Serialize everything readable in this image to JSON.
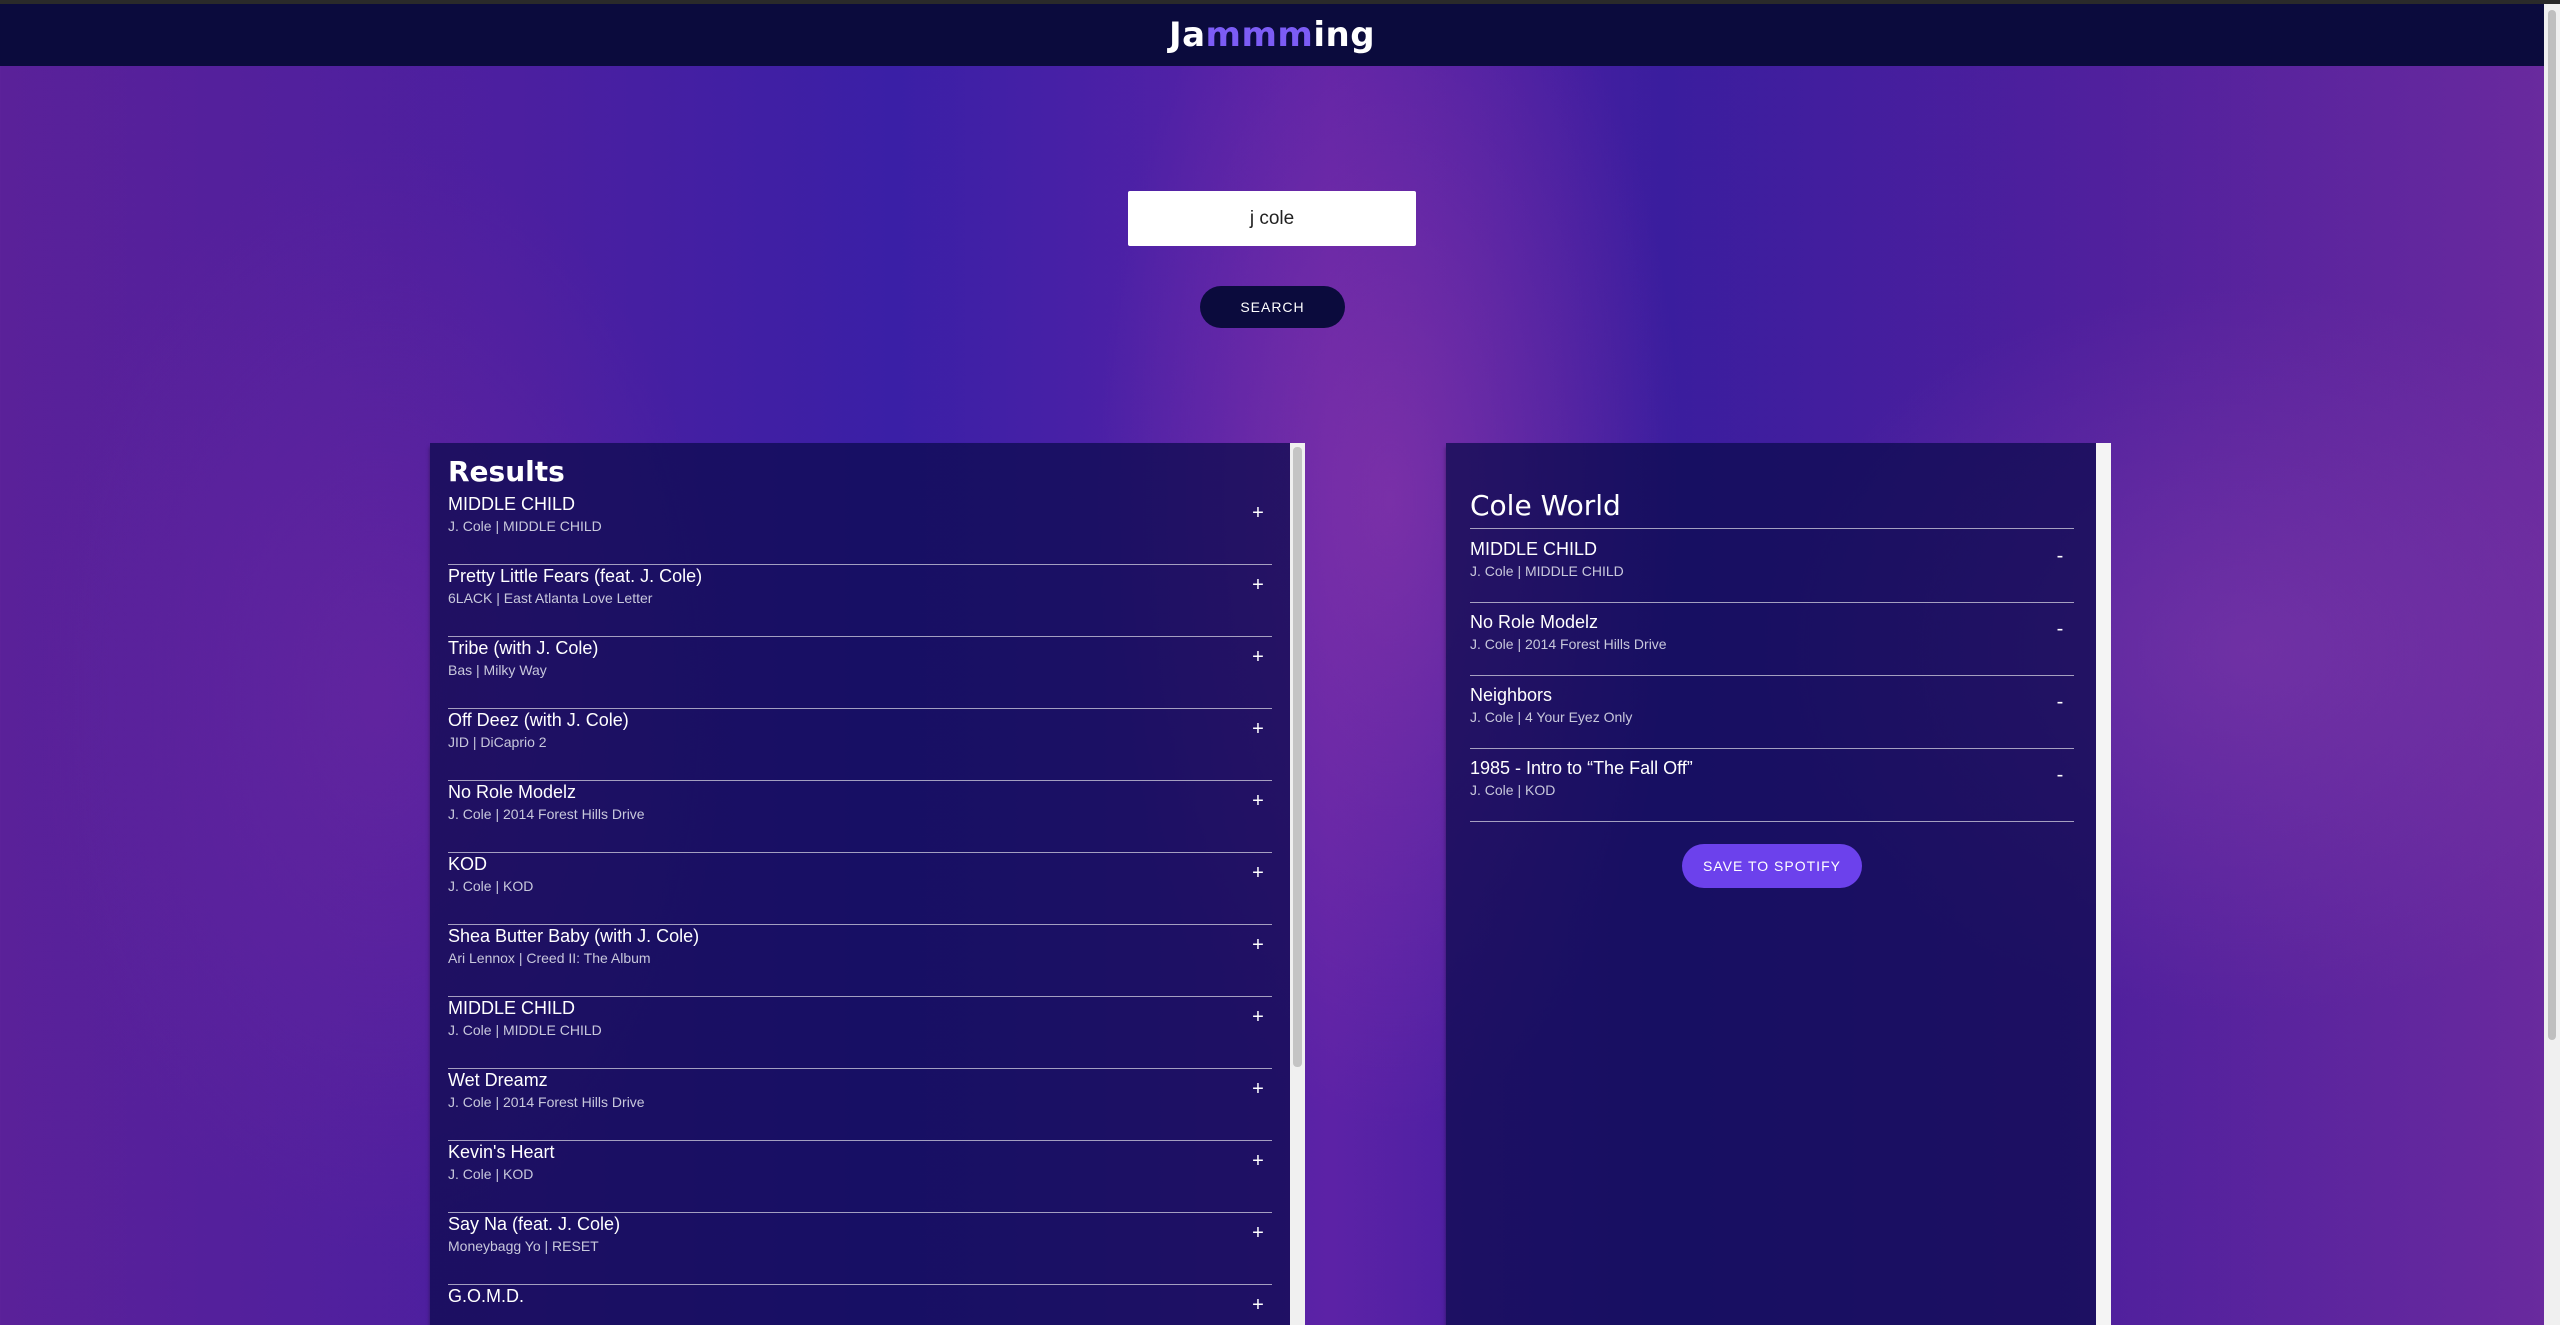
{
  "app": {
    "logo_start": "Ja",
    "logo_accent": "mmm",
    "logo_end": "ing"
  },
  "search": {
    "value": "j cole",
    "button_label": "SEARCH"
  },
  "results": {
    "title": "Results",
    "add_symbol": "+",
    "tracks": [
      {
        "name": "MIDDLE CHILD",
        "info": "J. Cole | MIDDLE CHILD"
      },
      {
        "name": "Pretty Little Fears (feat. J. Cole)",
        "info": "6LACK | East Atlanta Love Letter"
      },
      {
        "name": "Tribe (with J. Cole)",
        "info": "Bas | Milky Way"
      },
      {
        "name": "Off Deez (with J. Cole)",
        "info": "JID | DiCaprio 2"
      },
      {
        "name": "No Role Modelz",
        "info": "J. Cole | 2014 Forest Hills Drive"
      },
      {
        "name": "KOD",
        "info": "J. Cole | KOD"
      },
      {
        "name": "Shea Butter Baby (with J. Cole)",
        "info": "Ari Lennox | Creed II: The Album"
      },
      {
        "name": "MIDDLE CHILD",
        "info": "J. Cole | MIDDLE CHILD"
      },
      {
        "name": "Wet Dreamz",
        "info": "J. Cole | 2014 Forest Hills Drive"
      },
      {
        "name": "Kevin's Heart",
        "info": "J. Cole | KOD"
      },
      {
        "name": "Say Na (feat. J. Cole)",
        "info": "Moneybagg Yo | RESET"
      },
      {
        "name": "G.O.M.D.",
        "info": ""
      }
    ]
  },
  "playlist": {
    "name": "Cole World",
    "remove_symbol": "-",
    "save_label": "SAVE TO SPOTIFY",
    "tracks": [
      {
        "name": "MIDDLE CHILD",
        "info": "J. Cole | MIDDLE CHILD"
      },
      {
        "name": "No Role Modelz",
        "info": "J. Cole | 2014 Forest Hills Drive"
      },
      {
        "name": "Neighbors",
        "info": "J. Cole | 4 Your Eyez Only"
      },
      {
        "name": "1985 - Intro to “The Fall Off”",
        "info": "J. Cole | KOD"
      }
    ]
  }
}
